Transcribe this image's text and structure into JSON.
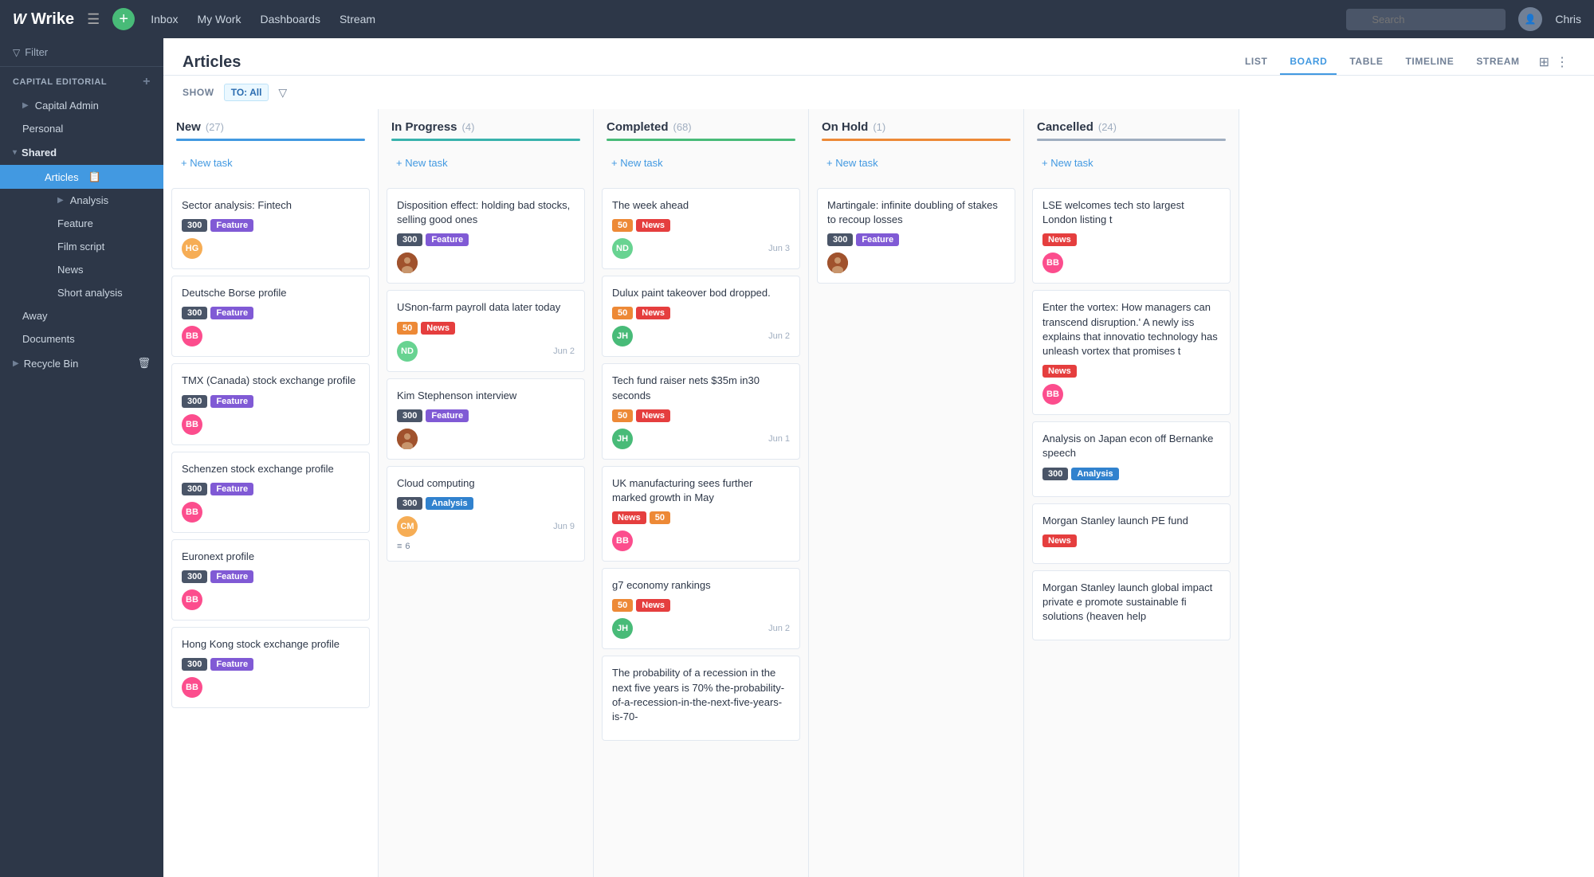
{
  "app": {
    "logo": "Wrike",
    "nav": {
      "inbox": "Inbox",
      "mywork": "My Work",
      "dashboards": "Dashboards",
      "stream": "Stream",
      "search_placeholder": "Search",
      "user": "Chris"
    }
  },
  "sidebar": {
    "filter_label": "Filter",
    "section_label": "CAPITAL EDITORIAL",
    "items": [
      {
        "id": "capital-admin",
        "label": "Capital Admin",
        "indent": 1
      },
      {
        "id": "personal",
        "label": "Personal",
        "indent": 1
      },
      {
        "id": "shared",
        "label": "Shared",
        "indent": 0
      },
      {
        "id": "articles",
        "label": "Articles",
        "indent": 2,
        "active": true
      },
      {
        "id": "analysis",
        "label": "Analysis",
        "indent": 3
      },
      {
        "id": "feature",
        "label": "Feature",
        "indent": 3
      },
      {
        "id": "film-script",
        "label": "Film script",
        "indent": 3
      },
      {
        "id": "news",
        "label": "News",
        "indent": 3
      },
      {
        "id": "short-analysis",
        "label": "Short analysis",
        "indent": 3
      },
      {
        "id": "away",
        "label": "Away",
        "indent": 1
      },
      {
        "id": "documents",
        "label": "Documents",
        "indent": 1
      },
      {
        "id": "recycle-bin",
        "label": "Recycle Bin",
        "indent": 0
      }
    ]
  },
  "page": {
    "title": "Articles",
    "tabs": [
      "LIST",
      "BOARD",
      "TABLE",
      "TIMELINE",
      "STREAM"
    ],
    "active_tab": "BOARD",
    "show_label": "SHOW",
    "filter_tag": "TO: All"
  },
  "columns": [
    {
      "id": "new",
      "title": "New",
      "count": 27,
      "bar_color": "bar-blue",
      "new_task_label": "+ New task",
      "cards": [
        {
          "title": "Sector analysis: Fintech",
          "tags": [
            {
              "label": "300",
              "class": "tag-300"
            },
            {
              "label": "Feature",
              "class": "tag-feature"
            }
          ],
          "avatar": "HG",
          "avatar_class": "avatar-hg",
          "date": ""
        },
        {
          "title": "Deutsche Borse profile",
          "tags": [
            {
              "label": "300",
              "class": "tag-300"
            },
            {
              "label": "Feature",
              "class": "tag-feature"
            }
          ],
          "avatar": "BB",
          "avatar_class": "avatar-bb",
          "date": ""
        },
        {
          "title": "TMX (Canada) stock exchange profile",
          "tags": [
            {
              "label": "300",
              "class": "tag-300"
            },
            {
              "label": "Feature",
              "class": "tag-feature"
            }
          ],
          "avatar": "BB",
          "avatar_class": "avatar-bb",
          "date": ""
        },
        {
          "title": "Schenzen stock exchange profile",
          "tags": [
            {
              "label": "300",
              "class": "tag-300"
            },
            {
              "label": "Feature",
              "class": "tag-feature"
            }
          ],
          "avatar": "BB",
          "avatar_class": "avatar-bb",
          "date": ""
        },
        {
          "title": "Euronext profile",
          "tags": [
            {
              "label": "300",
              "class": "tag-300"
            },
            {
              "label": "Feature",
              "class": "tag-feature"
            }
          ],
          "avatar": "BB",
          "avatar_class": "avatar-bb",
          "date": ""
        },
        {
          "title": "Hong Kong stock exchange profile",
          "tags": [
            {
              "label": "300",
              "class": "tag-300"
            },
            {
              "label": "Feature",
              "class": "tag-feature"
            }
          ],
          "avatar": "BB",
          "avatar_class": "avatar-bb",
          "date": ""
        }
      ]
    },
    {
      "id": "in-progress",
      "title": "In Progress",
      "count": 4,
      "bar_color": "bar-cyan",
      "new_task_label": "+ New task",
      "cards": [
        {
          "title": "Disposition effect: holding bad stocks, selling good ones",
          "tags": [
            {
              "label": "300",
              "class": "tag-300"
            },
            {
              "label": "Feature",
              "class": "tag-feature"
            }
          ],
          "avatar": "brown",
          "avatar_class": "avatar-brown",
          "date": ""
        },
        {
          "title": "USnon-farm payroll data later today",
          "tags": [
            {
              "label": "50",
              "class": "tag-50"
            },
            {
              "label": "News",
              "class": "tag-news"
            }
          ],
          "avatar": "ND",
          "avatar_class": "avatar-nd",
          "date": "Jun 2"
        },
        {
          "title": "Kim Stephenson interview",
          "tags": [
            {
              "label": "300",
              "class": "tag-300"
            },
            {
              "label": "Feature",
              "class": "tag-feature"
            }
          ],
          "avatar": "brown",
          "avatar_class": "avatar-brown",
          "date": ""
        },
        {
          "title": "Cloud computing",
          "tags": [
            {
              "label": "300",
              "class": "tag-300"
            },
            {
              "label": "Analysis",
              "class": "tag-analysis"
            }
          ],
          "avatar": "CM",
          "avatar_class": "avatar-cm",
          "date": "Jun 9",
          "subtasks": "6"
        }
      ]
    },
    {
      "id": "completed",
      "title": "Completed",
      "count": 68,
      "bar_color": "bar-green",
      "new_task_label": "+ New task",
      "cards": [
        {
          "title": "The week ahead",
          "tags": [
            {
              "label": "50",
              "class": "tag-50"
            },
            {
              "label": "News",
              "class": "tag-news"
            }
          ],
          "avatar": "ND",
          "avatar_class": "avatar-nd",
          "date": "Jun 3"
        },
        {
          "title": "Dulux paint takeover bod dropped.",
          "tags": [
            {
              "label": "50",
              "class": "tag-50"
            },
            {
              "label": "News",
              "class": "tag-news"
            }
          ],
          "avatar": "JH",
          "avatar_class": "avatar-jh",
          "date": "Jun 2"
        },
        {
          "title": "Tech fund raiser nets $35m in30 seconds",
          "tags": [
            {
              "label": "50",
              "class": "tag-50"
            },
            {
              "label": "News",
              "class": "tag-news"
            }
          ],
          "avatar": "JH",
          "avatar_class": "avatar-jh",
          "date": "Jun 1"
        },
        {
          "title": "UK manufacturing sees further marked growth in May",
          "tags": [
            {
              "label": "News",
              "class": "tag-news"
            },
            {
              "label": "50",
              "class": "tag-50"
            }
          ],
          "avatar": "BB",
          "avatar_class": "avatar-bb",
          "date": ""
        },
        {
          "title": "g7 economy rankings",
          "tags": [
            {
              "label": "50",
              "class": "tag-50"
            },
            {
              "label": "News",
              "class": "tag-news"
            }
          ],
          "avatar": "JH",
          "avatar_class": "avatar-jh",
          "date": "Jun 2"
        },
        {
          "title": "The probability of a recession in the next five years is 70% the-probability-of-a-recession-in-the-next-five-years-is-70-",
          "tags": [],
          "avatar": "",
          "avatar_class": "",
          "date": ""
        }
      ]
    },
    {
      "id": "on-hold",
      "title": "On Hold",
      "count": 1,
      "bar_color": "bar-orange",
      "new_task_label": "+ New task",
      "cards": [
        {
          "title": "Martingale: infinite doubling of stakes to recoup losses",
          "tags": [
            {
              "label": "300",
              "class": "tag-300"
            },
            {
              "label": "Feature",
              "class": "tag-feature"
            }
          ],
          "avatar": "brown",
          "avatar_class": "avatar-brown",
          "date": ""
        }
      ]
    },
    {
      "id": "cancelled",
      "title": "Cancelled",
      "count": 24,
      "bar_color": "bar-gray",
      "new_task_label": "+ New task",
      "cards": [
        {
          "title": "LSE welcomes tech sto largest London listing t",
          "tags": [
            {
              "label": "News",
              "class": "tag-news"
            }
          ],
          "avatar": "BB",
          "avatar_class": "avatar-bb",
          "date": ""
        },
        {
          "title": "Enter the vortex: How managers can transcend disruption.' A newly iss explains that innovatio technology has unleash vortex that promises t",
          "tags": [
            {
              "label": "News",
              "class": "tag-news"
            }
          ],
          "avatar": "BB",
          "avatar_class": "avatar-bb",
          "date": ""
        },
        {
          "title": "Analysis on Japan econ off Bernanke speech",
          "tags": [
            {
              "label": "300",
              "class": "tag-300"
            },
            {
              "label": "Analysis",
              "class": "tag-analysis"
            }
          ],
          "avatar": "",
          "avatar_class": "",
          "date": ""
        },
        {
          "title": "Morgan Stanley launch PE fund",
          "tags": [
            {
              "label": "News",
              "class": "tag-news"
            }
          ],
          "avatar": "",
          "avatar_class": "",
          "date": ""
        },
        {
          "title": "Morgan Stanley launch global impact private e promote sustainable fi solutions (heaven help",
          "tags": [],
          "avatar": "",
          "avatar_class": "",
          "date": ""
        }
      ]
    }
  ]
}
